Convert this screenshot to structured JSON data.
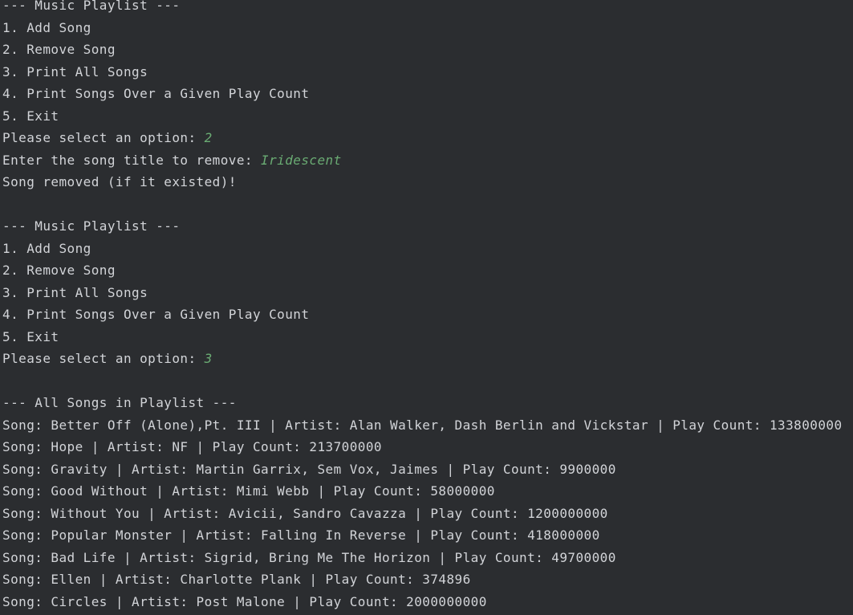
{
  "colors": {
    "background": "#2b2d30",
    "output_text": "#d2d4d8",
    "user_input": "#6aab73"
  },
  "lines": [
    {
      "text": "--- Music Playlist ---"
    },
    {
      "text": "1. Add Song"
    },
    {
      "text": "2. Remove Song"
    },
    {
      "text": "3. Print All Songs"
    },
    {
      "text": "4. Print Songs Over a Given Play Count"
    },
    {
      "text": "5. Exit"
    },
    {
      "text": "Please select an option: ",
      "input": "2"
    },
    {
      "text": "Enter the song title to remove: ",
      "input": "Iridescent"
    },
    {
      "text": "Song removed (if it existed)!"
    },
    {
      "text": ""
    },
    {
      "text": "--- Music Playlist ---"
    },
    {
      "text": "1. Add Song"
    },
    {
      "text": "2. Remove Song"
    },
    {
      "text": "3. Print All Songs"
    },
    {
      "text": "4. Print Songs Over a Given Play Count"
    },
    {
      "text": "5. Exit"
    },
    {
      "text": "Please select an option: ",
      "input": "3"
    },
    {
      "text": ""
    },
    {
      "text": "--- All Songs in Playlist ---"
    },
    {
      "text": "Song: Better Off (Alone),Pt. III | Artist: Alan Walker, Dash Berlin and Vickstar | Play Count: 133800000"
    },
    {
      "text": "Song: Hope | Artist: NF | Play Count: 213700000"
    },
    {
      "text": "Song: Gravity | Artist: Martin Garrix, Sem Vox, Jaimes | Play Count: 9900000"
    },
    {
      "text": "Song: Good Without | Artist: Mimi Webb | Play Count: 58000000"
    },
    {
      "text": "Song: Without You | Artist: Avicii, Sandro Cavazza | Play Count: 1200000000"
    },
    {
      "text": "Song: Popular Monster | Artist: Falling In Reverse | Play Count: 418000000"
    },
    {
      "text": "Song: Bad Life | Artist: Sigrid, Bring Me The Horizon | Play Count: 49700000"
    },
    {
      "text": "Song: Ellen | Artist: Charlotte Plank | Play Count: 374896"
    },
    {
      "text": "Song: Circles | Artist: Post Malone | Play Count: 2000000000"
    }
  ]
}
